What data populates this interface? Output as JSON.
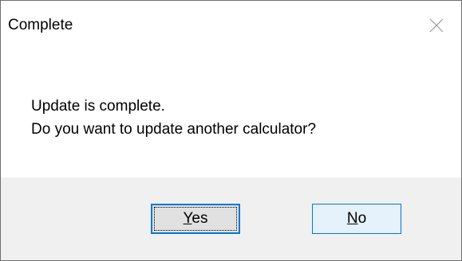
{
  "dialog": {
    "title": "Complete",
    "message_line1": "Update is complete.",
    "message_line2": "Do you want to update another calculator?"
  },
  "buttons": {
    "yes": {
      "mnemonic": "Y",
      "rest": "es"
    },
    "no": {
      "mnemonic": "N",
      "rest": "o"
    }
  },
  "icons": {
    "close": "close-icon"
  },
  "colors": {
    "accent": "#0078d7",
    "footer_background": "#f0f0f0",
    "yes_button_background": "#e1e1e1",
    "no_button_background": "#e5f1fb"
  }
}
